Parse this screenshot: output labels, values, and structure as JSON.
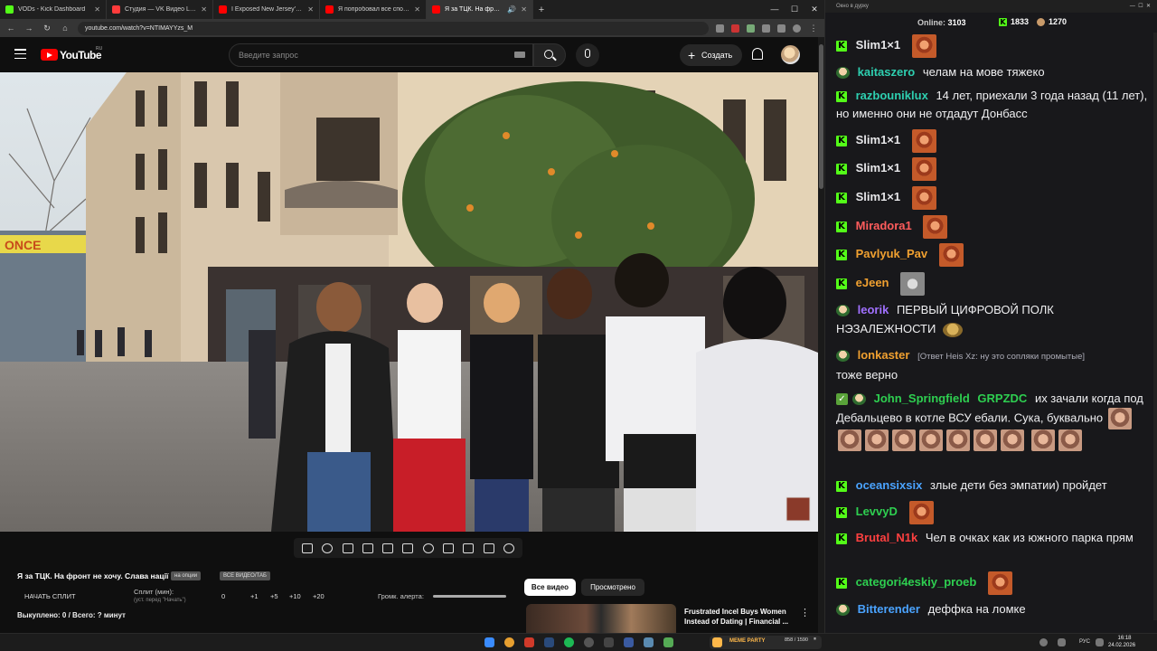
{
  "browser": {
    "tabs": [
      {
        "title": "VODs - Kick Dashboard",
        "color": "#53fc18",
        "active": false
      },
      {
        "title": "Студия — VK Видео Live",
        "color": "#ff3b3b",
        "active": false
      },
      {
        "title": "I Exposed New Jersey's Jewish",
        "color": "#ff0000",
        "active": false
      },
      {
        "title": "Я попробовал все способы б",
        "color": "#ff0000",
        "active": false
      },
      {
        "title": "Я за ТЦК. На фронт не хоч",
        "color": "#ff0000",
        "active": true
      }
    ],
    "url": "youtube.com/watch?v=NTIMAYYzs_M"
  },
  "youtube": {
    "brand": "YouTube",
    "region": "RU",
    "search_placeholder": "Введите запрос",
    "create_label": "Создать",
    "video_title": "Я за ТЦК. На фронт не хочу. Слава нації",
    "tag1": "на опции",
    "tag2": "ВСЕ ВИДЕО/ТАБ",
    "start_split": "НАЧАТЬ СПЛИТ",
    "split_label": "Сплит (мин):",
    "split_hint": "(уст. перед \"Начать\")",
    "split_values": [
      "0",
      "+1",
      "+5",
      "+10",
      "+20"
    ],
    "alert_volume": "Громк. алерта:",
    "bought": "Выкуплено: 0 / Всего: ? минут",
    "chip_all": "Все видео",
    "chip_watched": "Просмотрено",
    "rec_title": "Frustrated Incel Buys Women Instead of Dating | Financial ..."
  },
  "video_scene": {
    "shop_sign": "ONCE"
  },
  "chat": {
    "window_title": "Окно в дурку",
    "online_label": "Online:",
    "online_count": "3103",
    "kick_count": "1833",
    "yt_count": "1270",
    "messages": [
      {
        "platform": "kick",
        "user": "Slim1×1",
        "color": "#e7e7ea",
        "text": "",
        "emote": true
      },
      {
        "platform": "yt",
        "user": "kaitaszero",
        "color": "#2ecfb0",
        "text": "челам на мове тяжeко"
      },
      {
        "platform": "kick",
        "user": "razbouniklux",
        "color": "#2ecfb0",
        "text": "14 лет, приехали 3 года назад (11 лет), но именно они не отдадут Донбасс"
      },
      {
        "platform": "kick",
        "user": "Slim1×1",
        "color": "#e7e7ea",
        "text": "",
        "emote": true
      },
      {
        "platform": "kick",
        "user": "Slim1×1",
        "color": "#e7e7ea",
        "text": "",
        "emote": true
      },
      {
        "platform": "kick",
        "user": "Slim1×1",
        "color": "#e7e7ea",
        "text": "",
        "emote": true
      },
      {
        "platform": "kick",
        "user": "Miradora1",
        "color": "#ff5c5c",
        "text": "",
        "emote": true
      },
      {
        "platform": "kick",
        "user": "Pavlyuk_Pav",
        "color": "#f0a030",
        "text": "",
        "emote": true
      },
      {
        "platform": "kick",
        "user": "eJeen",
        "color": "#f0a030",
        "text": "",
        "emote": true
      },
      {
        "platform": "yt",
        "user": "leorik",
        "color": "#a070ff",
        "text": "ПЕРВЫЙ ЦИФРОВОЙ ПОЛК НЭЗАЛЕЖНОСТИ"
      },
      {
        "platform": "yt",
        "user": "lonkaster",
        "color": "#f0a030",
        "reply": "[Ответ Heis Xz: ну это сопляки промытые]",
        "text": "тоже верно"
      },
      {
        "platform": "yt",
        "user": "John_Springfield",
        "color": "#2ecf50",
        "mention": "GRPZDC",
        "text": "их зачали когда под Дебальцево в котле ВСУ ебали. Сука, буквально"
      },
      {
        "platform": "kick",
        "user": "oceansixsix",
        "color": "#4aa3ff",
        "text": "злые дети без эмпатии) пройдет"
      },
      {
        "platform": "kick",
        "user": "LevvyD",
        "color": "#2ecf50",
        "text": "",
        "emote": true
      },
      {
        "platform": "kick",
        "user": "Brutal_N1k",
        "color": "#ff4040",
        "text": "Чел в очках как из южного парка прям"
      },
      {
        "platform": "kick",
        "user": "categori4eskiy_proeb",
        "color": "#2ecf50",
        "text": "",
        "emote": true
      },
      {
        "platform": "yt",
        "user": "Bitterender",
        "color": "#4aa3ff",
        "text": "деффка на ломке"
      }
    ]
  },
  "taskbar": {
    "media_title": "MEME PARTY",
    "media_progress": "858 / 1590",
    "lang": "РУС",
    "time": "16:18",
    "date": "24.02.2026"
  }
}
